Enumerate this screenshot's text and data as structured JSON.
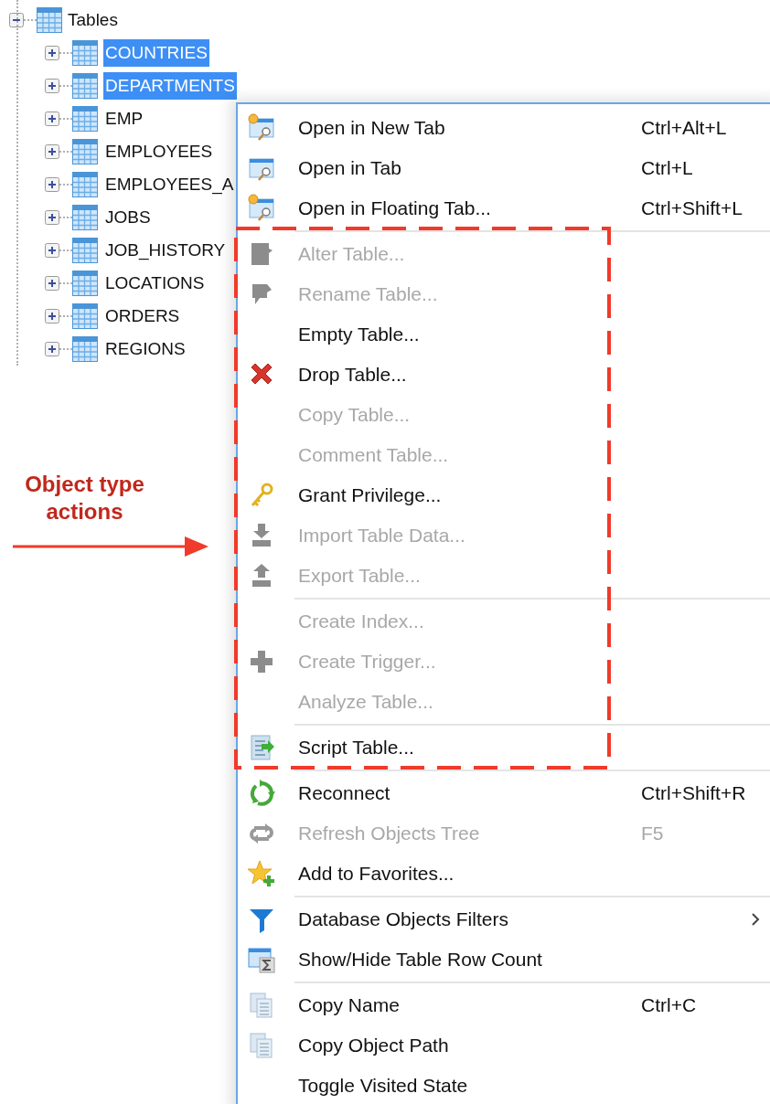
{
  "tree": {
    "label": "Tables",
    "expanded": true,
    "children": [
      {
        "label": "COUNTRIES",
        "selected": true
      },
      {
        "label": "DEPARTMENTS",
        "selected": true
      },
      {
        "label": "EMP",
        "selected": false
      },
      {
        "label": "EMPLOYEES",
        "selected": false
      },
      {
        "label": "EMPLOYEES_A",
        "selected": false
      },
      {
        "label": "JOBS",
        "selected": false
      },
      {
        "label": "JOB_HISTORY",
        "selected": false
      },
      {
        "label": "LOCATIONS",
        "selected": false
      },
      {
        "label": "ORDERS",
        "selected": false
      },
      {
        "label": "REGIONS",
        "selected": false
      }
    ]
  },
  "context_menu": {
    "groups": [
      [
        {
          "label": "Open in New Tab",
          "shortcut": "Ctrl+Alt+L",
          "disabled": false
        },
        {
          "label": "Open in Tab",
          "shortcut": "Ctrl+L",
          "disabled": false
        },
        {
          "label": "Open in Floating Tab...",
          "shortcut": "Ctrl+Shift+L",
          "disabled": false
        }
      ],
      [
        {
          "label": "Alter Table...",
          "disabled": true
        },
        {
          "label": "Rename Table...",
          "disabled": true
        },
        {
          "label": "Empty Table...",
          "disabled": false
        },
        {
          "label": "Drop Table...",
          "disabled": false
        },
        {
          "label": "Copy Table...",
          "disabled": true
        },
        {
          "label": "Comment Table...",
          "disabled": true
        },
        {
          "label": "Grant Privilege...",
          "disabled": false
        },
        {
          "label": "Import Table Data...",
          "disabled": true
        },
        {
          "label": "Export Table...",
          "disabled": true
        }
      ],
      [
        {
          "label": "Create Index...",
          "disabled": true
        },
        {
          "label": "Create Trigger...",
          "disabled": true
        },
        {
          "label": "Analyze Table...",
          "disabled": true
        }
      ],
      [
        {
          "label": "Script Table...",
          "disabled": false
        }
      ],
      [
        {
          "label": "Reconnect",
          "shortcut": "Ctrl+Shift+R",
          "disabled": false
        },
        {
          "label": "Refresh Objects Tree",
          "shortcut": "F5",
          "disabled": true
        },
        {
          "label": "Add to Favorites...",
          "disabled": false
        }
      ],
      [
        {
          "label": "Database Objects Filters",
          "disabled": false,
          "submenu": true
        },
        {
          "label": "Show/Hide Table Row Count",
          "disabled": false
        }
      ],
      [
        {
          "label": "Copy Name",
          "shortcut": "Ctrl+C",
          "disabled": false
        },
        {
          "label": "Copy Object Path",
          "disabled": false
        },
        {
          "label": "Toggle Visited State",
          "disabled": false
        }
      ]
    ]
  },
  "annotation": {
    "text": "Object type actions"
  }
}
